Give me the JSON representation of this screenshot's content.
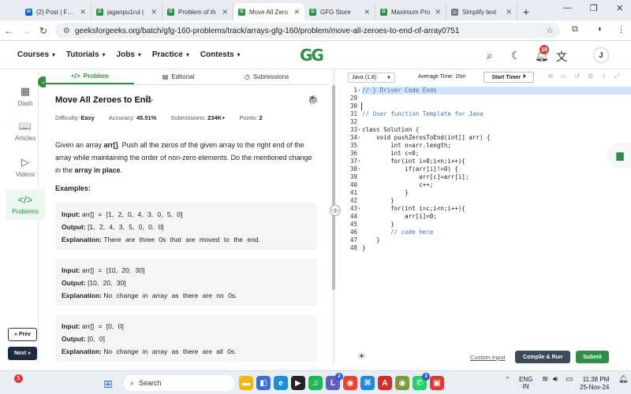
{
  "browser": {
    "tabs": [
      {
        "title": "(2) Post | Feed",
        "icon": "linkedin-icon",
        "color": "#0a66c2",
        "glyph": "in"
      },
      {
        "title": "jaganpu1rul |",
        "icon": "gfg-icon",
        "color": "#2f8d46",
        "glyph": "G"
      },
      {
        "title": "Problem of th",
        "icon": "gfg-icon",
        "color": "#2f8d46",
        "glyph": "G"
      },
      {
        "title": "Move All Zero",
        "icon": "gfg-icon",
        "color": "#2f8d46",
        "glyph": "G",
        "active": true
      },
      {
        "title": "GFG Store",
        "icon": "gfg-icon",
        "color": "#2f8d46",
        "glyph": "G"
      },
      {
        "title": "Maximum Pro",
        "icon": "gfg-icon",
        "color": "#2f8d46",
        "glyph": "G"
      },
      {
        "title": "Simplify text",
        "icon": "globe-icon",
        "color": "#777777",
        "glyph": "◎"
      }
    ],
    "url": "geeksforgeeks.org/batch/gfg-160-problems/track/arrays-gfg-160/problem/move-all-zeroes-to-end-of-array0751"
  },
  "header": {
    "menu": [
      {
        "label": "Courses",
        "name": "courses"
      },
      {
        "label": "Tutorials",
        "name": "tutorials"
      },
      {
        "label": "Jobs",
        "name": "jobs"
      },
      {
        "label": "Practice",
        "name": "practice"
      },
      {
        "label": "Contests",
        "name": "contests"
      }
    ],
    "logo": "GG",
    "notification_count": "18",
    "avatar_initial": "J"
  },
  "sidebar": {
    "items": [
      {
        "label": "Dash",
        "icon": "dashboard-icon",
        "glyph": "▦"
      },
      {
        "label": "Articles",
        "icon": "book-icon",
        "glyph": "📖"
      },
      {
        "label": "Videos",
        "icon": "play-icon",
        "glyph": "▷"
      },
      {
        "label": "Problems",
        "icon": "code-icon",
        "glyph": "</>",
        "active": true
      }
    ],
    "prev_label": "« Prev",
    "next_label": "Next »"
  },
  "problem": {
    "tabs": [
      {
        "label": "Problem",
        "glyph": "</>",
        "active": true
      },
      {
        "label": "Editorial",
        "glyph": "▤"
      },
      {
        "label": "Submissions",
        "glyph": "◷"
      }
    ],
    "title": "Move All Zeroes to End",
    "meta": {
      "difficulty_label": "Difficulty:",
      "difficulty": "Easy",
      "accuracy_label": "Accuracy:",
      "accuracy": "45.51%",
      "submissions_label": "Submissions:",
      "submissions": "234K+",
      "points_label": "Points:",
      "points": "2"
    },
    "description_parts": {
      "p1": "Given an array ",
      "b1": "arr[]",
      "p2": ". Push all the zeros of the given array to the right end of the array while maintaining the order of non-zero elements. Do the mentioned change in the ",
      "b2": "array in place",
      "p3": "."
    },
    "examples_label": "Examples:",
    "examples": [
      {
        "input": "arr[] = [1, 2, 0, 4, 3, 0, 5, 0]",
        "output": "[1, 2, 4, 3, 5, 0, 0, 0]",
        "explanation": "There are three 0s that are moved to the end."
      },
      {
        "input": "arr[] = [10, 20, 30]",
        "output": "[10, 20, 30]",
        "explanation": "No change in array as there are no 0s."
      },
      {
        "input": "arr[] = [0, 0]",
        "output": "[0, 0]",
        "explanation": "No change in array as there are all 0s."
      }
    ],
    "input_label": "Input:",
    "output_label": "Output:",
    "explanation_label": "Explanation:"
  },
  "editor": {
    "language": "Java (1.8)",
    "avg_time_label": "Average Time:",
    "avg_time": "15m",
    "timer_label": "Start Timer",
    "lines": [
      {
        "n": "1",
        "text": "// } Driver Code Ends",
        "hl": true,
        "comment": true,
        "fold": true
      },
      {
        "n": "29",
        "text": ""
      },
      {
        "n": "30",
        "text": ""
      },
      {
        "n": "31",
        "text": "// User function Template for Java",
        "comment": true
      },
      {
        "n": "32",
        "text": ""
      },
      {
        "n": "33",
        "text": "class Solution {",
        "fold": true
      },
      {
        "n": "34",
        "text": "    void pushZerosToEnd(int[] arr) {",
        "fold": true
      },
      {
        "n": "35",
        "text": "        int n=arr.length;"
      },
      {
        "n": "36",
        "text": "        int c=0;"
      },
      {
        "n": "37",
        "text": "        for(int i=0;i<n;i++){",
        "fold": true
      },
      {
        "n": "38",
        "text": "            if(arr[i]!=0) {",
        "fold": true
      },
      {
        "n": "39",
        "text": "                arr[c]=arr[i];"
      },
      {
        "n": "40",
        "text": "                c++;"
      },
      {
        "n": "41",
        "text": "            }"
      },
      {
        "n": "42",
        "text": "        }"
      },
      {
        "n": "43",
        "text": "        for(int i=c;i<n;i++){",
        "fold": true
      },
      {
        "n": "44",
        "text": "            arr[i]=0;"
      },
      {
        "n": "45",
        "text": "        }"
      },
      {
        "n": "46",
        "text": "        // code here",
        "comment": true
      },
      {
        "n": "47",
        "text": "    }"
      },
      {
        "n": "48",
        "text": "}"
      }
    ],
    "custom_input_label": "Custom Input",
    "compile_label": "Compile & Run",
    "submit_label": "Submit"
  },
  "taskbar": {
    "weather_badge": "1",
    "search_placeholder": "Search",
    "apps": [
      {
        "name": "file-explorer",
        "glyph": "▬",
        "color": "#f2b90f"
      },
      {
        "name": "store",
        "glyph": "◧",
        "color": "#3a6fd8"
      },
      {
        "name": "edge",
        "glyph": "e",
        "color": "#1b8fd6"
      },
      {
        "name": "media",
        "glyph": "▶",
        "color": "#222"
      },
      {
        "name": "spotify",
        "glyph": "♫",
        "color": "#1db954"
      },
      {
        "name": "teams",
        "glyph": "L",
        "color": "#5b5fc7",
        "badge": "2"
      },
      {
        "name": "chrome",
        "glyph": "◉",
        "color": "#e84335"
      },
      {
        "name": "vscode",
        "glyph": "⌘",
        "color": "#1e88e5"
      },
      {
        "name": "acrobat",
        "glyph": "A",
        "color": "#d32f2f"
      },
      {
        "name": "chrome-profile",
        "glyph": "◉",
        "color": "#7c9b3a"
      },
      {
        "name": "whatsapp",
        "glyph": "✆",
        "color": "#25d366",
        "badge": "3"
      },
      {
        "name": "extra-app",
        "glyph": "▣",
        "color": "#e53935"
      }
    ],
    "lang_top": "ENG",
    "lang_bottom": "IN",
    "time": "11:38 PM",
    "date": "25-Nov-24"
  }
}
